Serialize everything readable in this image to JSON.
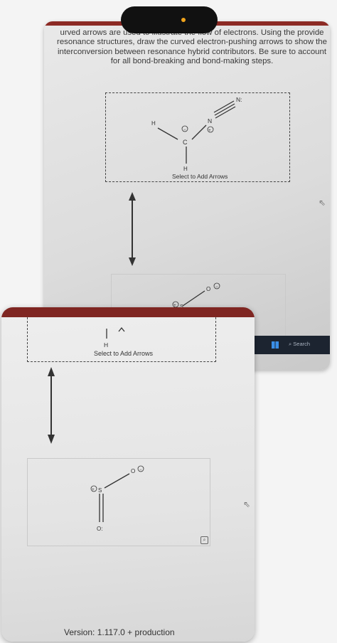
{
  "instructions": {
    "line1": "urved arrows are used to illustrate the flow of electrons. Using the provide",
    "line2": "resonance structures, draw the curved electron-pushing arrows to show the",
    "line3": "interconversion between resonance hybrid contributors. Be sure to account",
    "line4": "for all bond-breaking and bond-making steps."
  },
  "top_panel": {
    "caption": "Select to Add Arrows",
    "atoms": {
      "h_left": "H",
      "c": "C",
      "h_bottom": "H",
      "n1": "N",
      "n2": "N:"
    }
  },
  "bottom_panel_top": {
    "atoms": {
      "s": "S",
      "o": "O"
    }
  },
  "taskbar": {
    "search": "Search"
  },
  "lower_screen": {
    "atom_h": "H",
    "caption": "Select to Add Arrows",
    "atoms": {
      "s": "S",
      "o_right": "O",
      "o_bottom": "O:"
    },
    "zoom_icon": "magnifier-icon",
    "version": "Version: 1.117.0 + production"
  }
}
